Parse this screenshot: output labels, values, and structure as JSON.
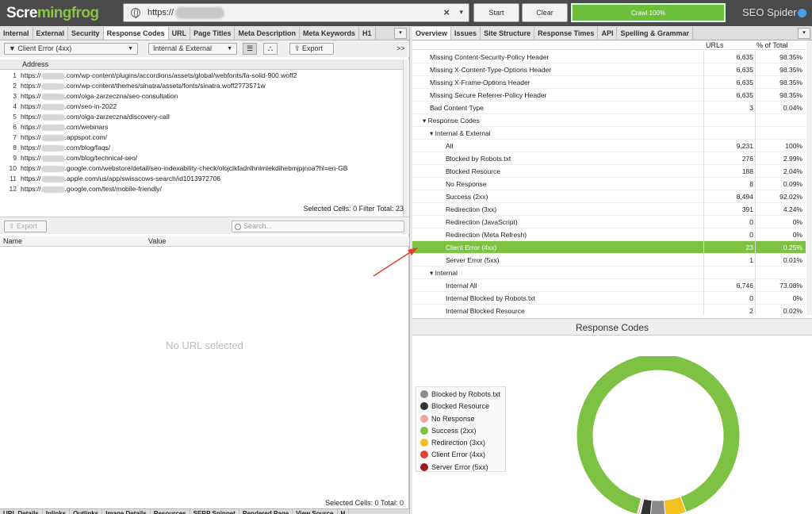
{
  "app": {
    "logo_prefix": "Scre",
    "logo_suffix": "mingfrog",
    "product": "SEO",
    "product2": "Spider"
  },
  "urlbar": {
    "value": "https://",
    "clear_x": "×",
    "dropdown": "▾"
  },
  "buttons": {
    "start": "Start",
    "clear": "Clear",
    "crawl": "Crawl 100%"
  },
  "left_tabs": [
    "Internal",
    "External",
    "Security",
    "Response Codes",
    "URL",
    "Page Titles",
    "Meta Description",
    "Meta Keywords",
    "H1"
  ],
  "left_tab_more": "▾",
  "right_tabs": [
    "Overview",
    "Issues",
    "Site Structure",
    "Response Times",
    "API",
    "Spelling & Grammar"
  ],
  "right_tab_more": "▾",
  "filter": {
    "value": "Client Error (4xx)",
    "scope": "Internal & External",
    "export": "Export",
    "expand": ">>"
  },
  "table": {
    "header": "Address",
    "rows": [
      {
        "n": "1",
        "pre": "https://",
        "post": ".com/wp-content/plugins/accordions/assets/global/webfonts/fa-solid-900.woff2"
      },
      {
        "n": "2",
        "pre": "https://",
        "post": ".com/wp-content/themes/sinatra/assets/fonts/sinatra.woff2?73571w"
      },
      {
        "n": "3",
        "pre": "https://",
        "post": ".com/olga-zarzeczna/seo-consultation"
      },
      {
        "n": "4",
        "pre": "https://",
        "post": ".com/seo-in-2022"
      },
      {
        "n": "5",
        "pre": "https://",
        "post": ".com/olga-zarzeczna/discovery-call"
      },
      {
        "n": "6",
        "pre": "https://",
        "post": ".com/webinars"
      },
      {
        "n": "7",
        "pre": "https://",
        "post": ".appspot.com/"
      },
      {
        "n": "8",
        "pre": "https://",
        "post": ".com/blog/faqs/"
      },
      {
        "n": "9",
        "pre": "https://",
        "post": ".com/blog/technical-seo/"
      },
      {
        "n": "10",
        "pre": "https://",
        "post": ".google.com/webstore/detail/seo-indexability-check/olojclkfadnlhnlmlekdihebmjpjnoa?hl=en-GB"
      },
      {
        "n": "11",
        "pre": "https://",
        "post": ".apple.com/us/app/swisscows-search/id1013972706"
      },
      {
        "n": "12",
        "pre": "https://",
        "post": ".google.com/test/mobile-friendly/"
      }
    ]
  },
  "status_top": "Selected Cells:  0  Filter Total:  23",
  "lower": {
    "export": "Export",
    "search_placeholder": "Search...",
    "col_name": "Name",
    "col_value": "Value",
    "empty": "No URL selected",
    "status": "Selected Cells:  0  Total:  0"
  },
  "bottom_tabs": [
    "URL Details",
    "Inlinks",
    "Outlinks",
    "Image Details",
    "Resources",
    "SERP Snippet",
    "Rendered Page",
    "View Source",
    "H"
  ],
  "overview": {
    "col_urls": "URLs",
    "col_pct": "% of Total",
    "rows": [
      {
        "label": "Missing Content-Security-Policy Header",
        "urls": "6,635",
        "pct": "98.35%",
        "indent": 1
      },
      {
        "label": "Missing X-Content-Type-Options Header",
        "urls": "6,635",
        "pct": "98.35%",
        "indent": 1
      },
      {
        "label": "Missing X-Frame-Options Header",
        "urls": "6,635",
        "pct": "98.35%",
        "indent": 1
      },
      {
        "label": "Missing Secure Referrer-Policy Header",
        "urls": "6,635",
        "pct": "98.35%",
        "indent": 1
      },
      {
        "label": "Bad Content Type",
        "urls": "3",
        "pct": "0.04%",
        "indent": 1
      },
      {
        "label": "▾  Response Codes",
        "urls": "",
        "pct": "",
        "indent": 0
      },
      {
        "label": "▾  Internal & External",
        "urls": "",
        "pct": "",
        "indent": 1
      },
      {
        "label": "All",
        "urls": "9,231",
        "pct": "100%",
        "indent": 2
      },
      {
        "label": "Blocked by Robots.txt",
        "urls": "276",
        "pct": "2.99%",
        "indent": 2
      },
      {
        "label": "Blocked Resource",
        "urls": "188",
        "pct": "2.04%",
        "indent": 2
      },
      {
        "label": "No Response",
        "urls": "8",
        "pct": "0.09%",
        "indent": 2
      },
      {
        "label": "Success (2xx)",
        "urls": "8,494",
        "pct": "92.02%",
        "indent": 2
      },
      {
        "label": "Redirection (3xx)",
        "urls": "391",
        "pct": "4.24%",
        "indent": 2
      },
      {
        "label": "Redirection (JavaScript)",
        "urls": "0",
        "pct": "0%",
        "indent": 2
      },
      {
        "label": "Redirection (Meta Refresh)",
        "urls": "0",
        "pct": "0%",
        "indent": 2
      },
      {
        "label": "Client Error (4xx)",
        "urls": "23",
        "pct": "0.25%",
        "indent": 2,
        "selected": true
      },
      {
        "label": "Server Error (5xx)",
        "urls": "1",
        "pct": "0.01%",
        "indent": 2
      },
      {
        "label": "▾  Internal",
        "urls": "",
        "pct": "",
        "indent": 1
      },
      {
        "label": "Internal All",
        "urls": "6,746",
        "pct": "73.08%",
        "indent": 2
      },
      {
        "label": "Internal Blocked by Robots.txt",
        "urls": "0",
        "pct": "0%",
        "indent": 2
      },
      {
        "label": "Internal Blocked Resource",
        "urls": "2",
        "pct": "0.02%",
        "indent": 2
      }
    ]
  },
  "chart_title": "Response Codes",
  "legend": [
    {
      "label": "Blocked by Robots.txt",
      "color": "#8a8a8a"
    },
    {
      "label": "Blocked Resource",
      "color": "#333333"
    },
    {
      "label": "No Response",
      "color": "#f2a5a5"
    },
    {
      "label": "Success (2xx)",
      "color": "#7dc242"
    },
    {
      "label": "Redirection (3xx)",
      "color": "#f4c020"
    },
    {
      "label": "Client Error (4xx)",
      "color": "#e0423a"
    },
    {
      "label": "Server Error (5xx)",
      "color": "#9e1b1b"
    }
  ],
  "donut": {
    "values": [
      276,
      188,
      8,
      8494,
      391,
      23,
      1
    ],
    "colors": [
      "#8a8a8a",
      "#333333",
      "#f2a5a5",
      "#7dc242",
      "#f4c020",
      "#e0423a",
      "#9e1b1b"
    ],
    "labels": [
      "Blocked by Robots.txt",
      "Blocked Resource",
      "No Response",
      "Success (2xx)",
      "Redirection (3xx)",
      "Client Error (4xx)",
      "Server Error (5xx)"
    ]
  }
}
